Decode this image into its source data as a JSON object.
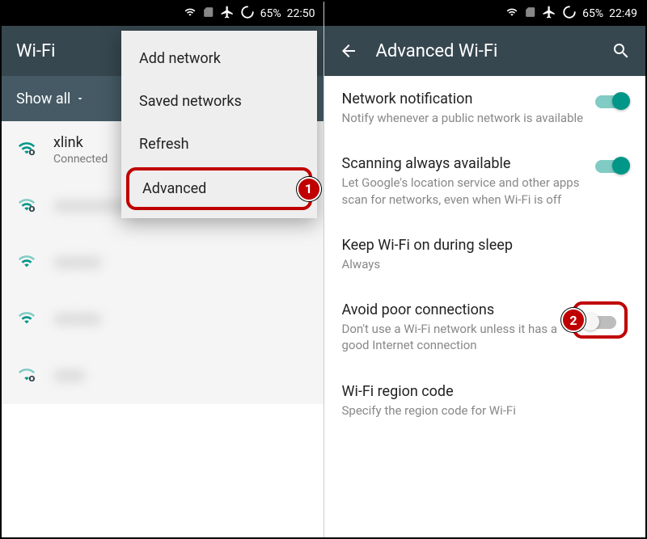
{
  "left": {
    "statusbar": {
      "battery": "65%",
      "time": "22:50"
    },
    "appbar": {
      "title": "Wi-Fi"
    },
    "filter": {
      "label": "Show all"
    },
    "networks": [
      {
        "name": "xlink",
        "status": "Connected",
        "signal": 3,
        "secured": true
      }
    ],
    "menu": [
      {
        "label": "Add network"
      },
      {
        "label": "Saved networks"
      },
      {
        "label": "Refresh"
      },
      {
        "label": "Advanced"
      }
    ],
    "callout": "1"
  },
  "right": {
    "statusbar": {
      "battery": "65%",
      "time": "22:49"
    },
    "appbar": {
      "title": "Advanced Wi-Fi"
    },
    "settings": [
      {
        "title": "Network notification",
        "desc": "Notify whenever a public network is available",
        "toggle": "on"
      },
      {
        "title": "Scanning always available",
        "desc": "Let Google's location service and other apps scan for networks, even when Wi-Fi is off",
        "toggle": "on"
      },
      {
        "title": "Keep Wi-Fi on during sleep",
        "desc": "Always"
      },
      {
        "title": "Avoid poor connections",
        "desc": "Don't use a Wi-Fi network unless it has a good Internet connection",
        "toggle": "off",
        "highlight": true
      },
      {
        "title": "Wi-Fi region code",
        "desc": "Specify the region code for Wi-Fi"
      }
    ],
    "callout": "2"
  }
}
